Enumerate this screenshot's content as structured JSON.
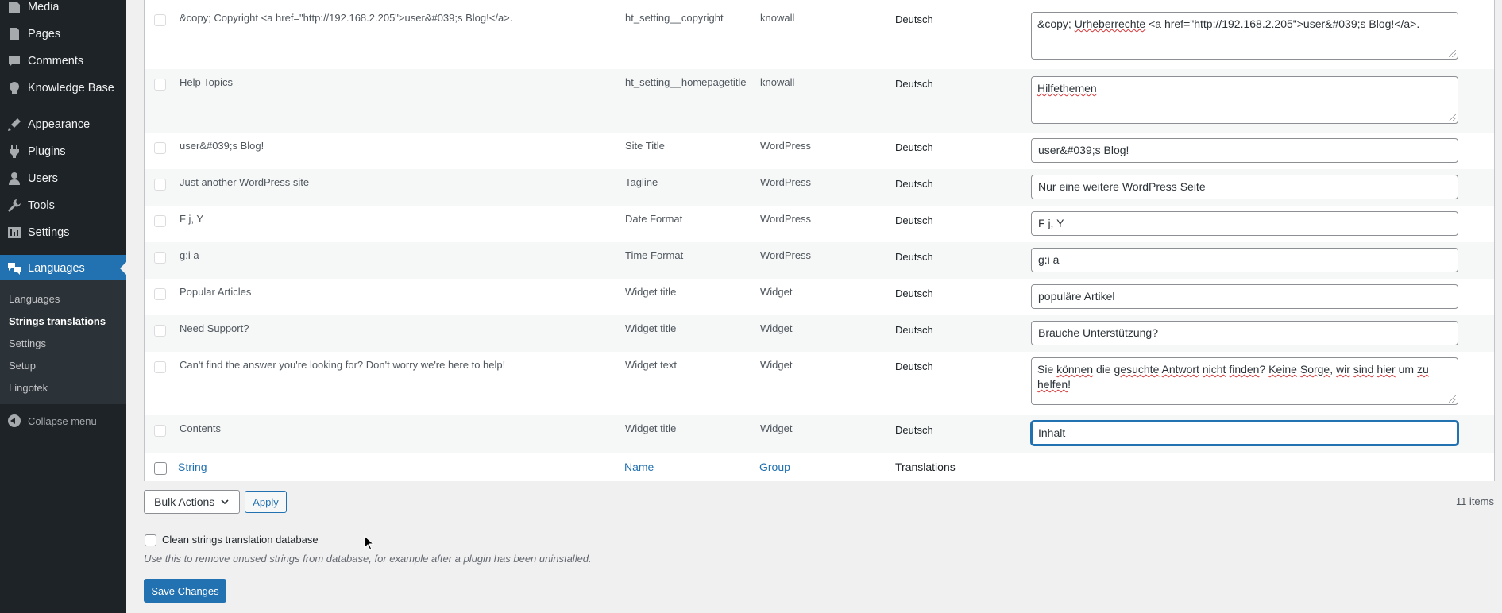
{
  "sidebar": {
    "menu": [
      {
        "label": "Media",
        "icon": "media-icon"
      },
      {
        "label": "Pages",
        "icon": "pages-icon"
      },
      {
        "label": "Comments",
        "icon": "comments-icon"
      },
      {
        "label": "Knowledge Base",
        "icon": "lightbulb-icon"
      },
      {
        "label": "Appearance",
        "icon": "paintbrush-icon"
      },
      {
        "label": "Plugins",
        "icon": "plugin-icon"
      },
      {
        "label": "Users",
        "icon": "users-icon"
      },
      {
        "label": "Tools",
        "icon": "wrench-icon"
      },
      {
        "label": "Settings",
        "icon": "settings-icon"
      },
      {
        "label": "Languages",
        "icon": "translation-icon"
      }
    ],
    "submenu": [
      "Languages",
      "Strings translations",
      "Settings",
      "Setup",
      "Lingotek"
    ],
    "collapse_label": "Collapse menu"
  },
  "rows": [
    {
      "string": "&copy; Copyright <a href=\"http://192.168.2.205\">user&#039;s Blog!</a>.",
      "name": "ht_setting__copyright",
      "group": "knowall",
      "language": "Deutsch",
      "translation": "&copy; Urheberrechte <a href=\"http://192.168.2.205\">user&#039;s Blog!</a>."
    },
    {
      "string": "Help Topics",
      "name": "ht_setting__homepagetitle",
      "group": "knowall",
      "language": "Deutsch",
      "translation": "Hilfethemen"
    },
    {
      "string": "user&#039;s Blog!",
      "name": "Site Title",
      "group": "WordPress",
      "language": "Deutsch",
      "translation": "user&#039;s Blog!"
    },
    {
      "string": "Just another WordPress site",
      "name": "Tagline",
      "group": "WordPress",
      "language": "Deutsch",
      "translation": "Nur eine weitere WordPress Seite"
    },
    {
      "string": "F j, Y",
      "name": "Date Format",
      "group": "WordPress",
      "language": "Deutsch",
      "translation": "F j, Y"
    },
    {
      "string": "g:i a",
      "name": "Time Format",
      "group": "WordPress",
      "language": "Deutsch",
      "translation": "g:i a"
    },
    {
      "string": "Popular Articles",
      "name": "Widget title",
      "group": "Widget",
      "language": "Deutsch",
      "translation": "populäre Artikel"
    },
    {
      "string": "Need Support?",
      "name": "Widget title",
      "group": "Widget",
      "language": "Deutsch",
      "translation": "Brauche Unterstützung?"
    },
    {
      "string": "Can't find the answer you're looking for? Don't worry we're here to help!",
      "name": "Widget text",
      "group": "Widget",
      "language": "Deutsch",
      "translation": "Sie können die gesuchte Antwort nicht finden? Keine Sorge, wir sind hier um zu helfen!"
    },
    {
      "string": "Contents",
      "name": "Widget title",
      "group": "Widget",
      "language": "Deutsch",
      "translation": "Inhalt"
    }
  ],
  "columns": {
    "string": "String",
    "name": "Name",
    "group": "Group",
    "translations": "Translations"
  },
  "bulk_actions": {
    "selected": "Bulk Actions",
    "apply": "Apply"
  },
  "items_count": "11 items",
  "clean": {
    "label": "Clean strings translation database",
    "description": "Use this to remove unused strings from database, for example after a plugin has been uninstalled."
  },
  "save_label": "Save Changes",
  "colors": {
    "accent": "#2271b1",
    "sidebar": "#1d2327",
    "submenu": "#2c3338"
  }
}
